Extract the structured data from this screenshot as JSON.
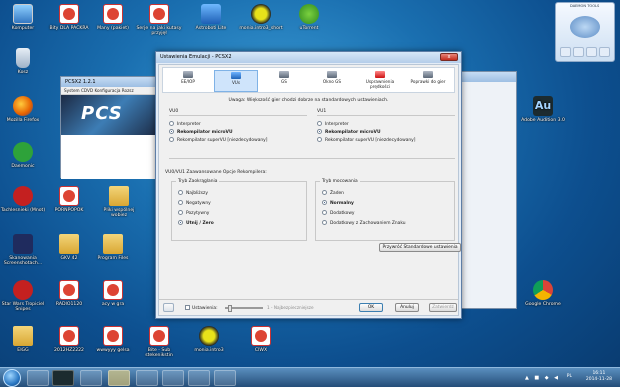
{
  "desktop": {
    "icons": [
      {
        "label": "Komputer",
        "kind": "computer"
      },
      {
        "label": "Bity DLA PACKRA",
        "kind": "pdf"
      },
      {
        "label": "Many (pakiet)",
        "kind": "pdf"
      },
      {
        "label": "Serje na jaki kutasy przyjęł",
        "kind": "pdf"
      },
      {
        "label": "Astroboti Lite",
        "kind": "astro"
      },
      {
        "label": "monia.intro3_short",
        "kind": "wav"
      },
      {
        "label": "uTorrent",
        "kind": "utor"
      },
      {
        "label": "Kosz",
        "kind": "trash"
      },
      {
        "label": "Mozilla Firefox",
        "kind": "firefox"
      },
      {
        "label": "Daemonic",
        "kind": "green"
      },
      {
        "label": "Tachlesnieki (Mnot)",
        "kind": "red"
      },
      {
        "label": "PORNPOPOK",
        "kind": "pdf"
      },
      {
        "label": "Pliki wspólnej wobiez",
        "kind": "folder"
      },
      {
        "label": "Skanowania Screenshotach...",
        "kind": "dark"
      },
      {
        "label": "GKV 42",
        "kind": "folder"
      },
      {
        "label": "Program Files",
        "kind": "folder"
      },
      {
        "label": "Star Wars Tropiciel Snipes",
        "kind": "red"
      },
      {
        "label": "RADIO1120",
        "kind": "pdf"
      },
      {
        "label": "acy w gra",
        "kind": "pdf"
      },
      {
        "label": "EIGG",
        "kind": "folder"
      },
      {
        "label": "2012HZ2222",
        "kind": "pdf"
      },
      {
        "label": "wwwyyy gelsa",
        "kind": "pdf"
      },
      {
        "label": "Bite - Sub stekenikstin",
        "kind": "pdf"
      },
      {
        "label": "monia.intro3",
        "kind": "wav"
      },
      {
        "label": "CIWX",
        "kind": "pdf"
      },
      {
        "label": "Adobe Audition 3.0",
        "kind": "au"
      },
      {
        "label": "Google Chrome",
        "kind": "chrome"
      }
    ]
  },
  "pcsx2": {
    "title": "PCSX2  1.2.1",
    "menu": "System   CDVD   Konfiguracja   Rozsz",
    "banner": "PCS"
  },
  "daemon": {
    "header": "DAEMON TOOLS",
    "disc_label": "(E:)"
  },
  "dialog": {
    "title": "Ustawienia Emulacji - PCSX2",
    "close_label": "x",
    "tabs": [
      "EE/IOP",
      "VUs",
      "GS",
      "Okno GS",
      "Usprawnienia prędkości",
      "Poprawki do gier"
    ],
    "active_tab": 1,
    "notice": "Uwaga: Większość gier chodzi dobrze na standardowych ustawieniach.",
    "vu0": {
      "title": "VU0",
      "options": [
        "Interpreter",
        "Rekompilator microVU",
        "Rekompilator superVU [niezdecydowany]"
      ],
      "selected": 1
    },
    "vu1": {
      "title": "VU1",
      "options": [
        "Interpreter",
        "Rekompilator microVU",
        "Rekompilator superVU [niezdecydowany]"
      ],
      "selected": 1
    },
    "advanced_title": "VU0/VU1 Zaawansowane Opcje Rekompilera:",
    "rounding": {
      "legend": "Tryb Zaokrąglania",
      "options": [
        "Najbliższy",
        "Negatywny",
        "Pozytywny",
        "Utnij / Zero"
      ],
      "selected": 3
    },
    "clamping": {
      "legend": "Tryb mocowania",
      "options": [
        "Żaden",
        "Normalny",
        "Dodatkowy",
        "Dodatkowy z Zachowaniem Znaku"
      ],
      "selected": 1
    },
    "restore_button": "Przywróć Standardowe ustawienia",
    "presets_checkbox": "Ustawienia:",
    "presets_checked": false,
    "slider_label": "1 - Najbezpieczniejsze",
    "ok_button": "OK",
    "cancel_button": "Anuluj",
    "apply_button": "Zatwierdź"
  },
  "taskbar": {
    "language": "PL",
    "time": "16:11",
    "date": "2014-11-28"
  }
}
